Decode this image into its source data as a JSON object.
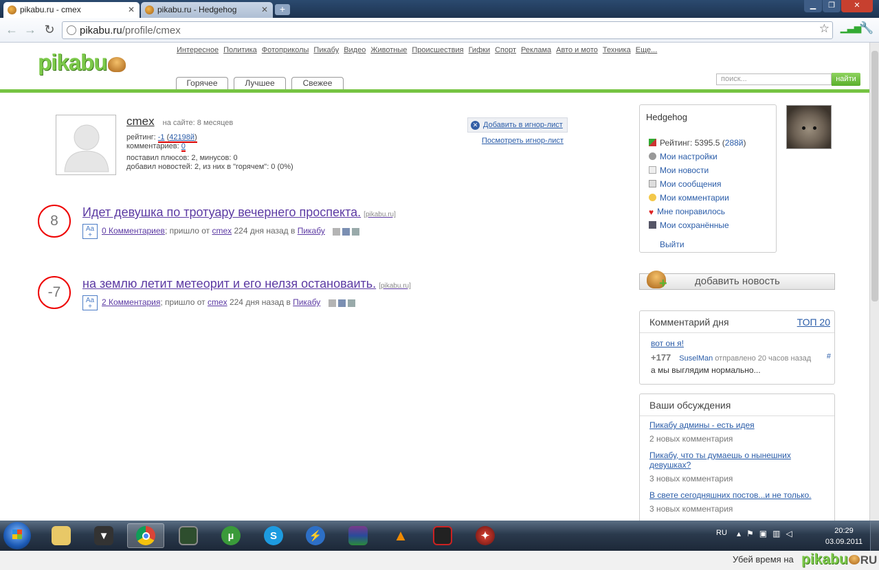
{
  "browser": {
    "tabs": [
      {
        "title": "pikabu.ru - cmex"
      },
      {
        "title": "pikabu.ru - Hedgehog"
      }
    ],
    "url_host": "pikabu.ru",
    "url_path": "/profile/cmex"
  },
  "site": {
    "logo": "pikabu",
    "nav": [
      "Интересное",
      "Политика",
      "Фотоприколы",
      "Пикабу",
      "Видео",
      "Животные",
      "Происшествия",
      "Гифки",
      "Спорт",
      "Реклама",
      "Авто и мото",
      "Техника",
      "Еще..."
    ],
    "tabs": [
      "Горячее",
      "Лучшее",
      "Свежее"
    ],
    "search_placeholder": "поиск...",
    "search_button": "найти"
  },
  "profile": {
    "username": "cmex",
    "on_site": "на сайте: 8 месяцев",
    "rating_label": "рейтинг: ",
    "rating_value": "-1",
    "rating_rank": "42198й",
    "comments_label": "комментариев: ",
    "comments_value": "0",
    "pluses_line": "поставил плюсов: 2, минусов: 0",
    "news_line": "добавил новостей: 2, из них в \"горячем\": 0 (0%)",
    "ignore_add": "Добавить в игнор-лист",
    "ignore_view": "Посмотреть игнор-лист"
  },
  "posts": [
    {
      "rating": "8",
      "title": "Идет девушка по тротуару вечернего проспекта.",
      "source": "[pikabu.ru]",
      "comments": "0 Комментариев",
      "came_from": "; пришло от ",
      "author": "cmex",
      "ago": " 224 дня назад в ",
      "category": "Пикабу",
      "aa": "Aa"
    },
    {
      "rating": "-7",
      "title": "на землю летит метеорит и его нелзя остановаить.",
      "source": "[pikabu.ru]",
      "comments": "2 Комментария",
      "came_from": "; пришло от ",
      "author": "cmex",
      "ago": " 224 дня назад в ",
      "category": "Пикабу",
      "aa": "Aa"
    }
  ],
  "user_panel": {
    "name": "Hedgehog",
    "rating_label": "Рейтинг: 5395.5 (",
    "rating_rank": "288й",
    "rating_close": ")",
    "items": [
      "Мои настройки",
      "Мои новости",
      "Мои сообщения",
      "Мои комментарии",
      "Мне понравилось",
      "Мои сохранённые"
    ],
    "logout": "Выйти"
  },
  "add_news": "добавить новость",
  "comment_of_day": {
    "title": "Комментарий дня",
    "top": "ТОП 20",
    "link": "вот он я!",
    "score": "+177",
    "user": "SuselMan",
    "sent": " отправлено 20 часов назад",
    "hash": "#",
    "text": "а мы выглядим нормально..."
  },
  "discussions": {
    "title": "Ваши обсуждения",
    "items": [
      {
        "title": "Пикабу админы - есть идея",
        "count": "2 новых комментария"
      },
      {
        "title": "Пикабу, что ты думаешь о нынешних девушках?",
        "count": "3 новых комментария"
      },
      {
        "title": "В свете сегодняшних постов...и не только.",
        "count": "3 новых комментария"
      }
    ]
  },
  "taskbar": {
    "lang": "RU",
    "time": "20:29",
    "date": "03.09.2011"
  },
  "bottom": {
    "text": "Убей время на",
    "logo": "pikabu",
    "suffix": "RU"
  }
}
